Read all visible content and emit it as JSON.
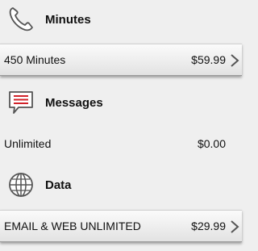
{
  "sections": [
    {
      "title": "Minutes",
      "icon": "phone-icon",
      "item": {
        "label": "450 Minutes",
        "price": "$59.99",
        "has_chevron": true
      }
    },
    {
      "title": "Messages",
      "icon": "message-icon",
      "item": {
        "label": "Unlimited",
        "price": "$0.00",
        "has_chevron": false
      }
    },
    {
      "title": "Data",
      "icon": "globe-icon",
      "item": {
        "label": "EMAIL & WEB UNLIMITED",
        "price": "$29.99",
        "has_chevron": true
      }
    }
  ],
  "colors": {
    "background": "#efefef",
    "message_icon_accent": "#d2232a"
  }
}
